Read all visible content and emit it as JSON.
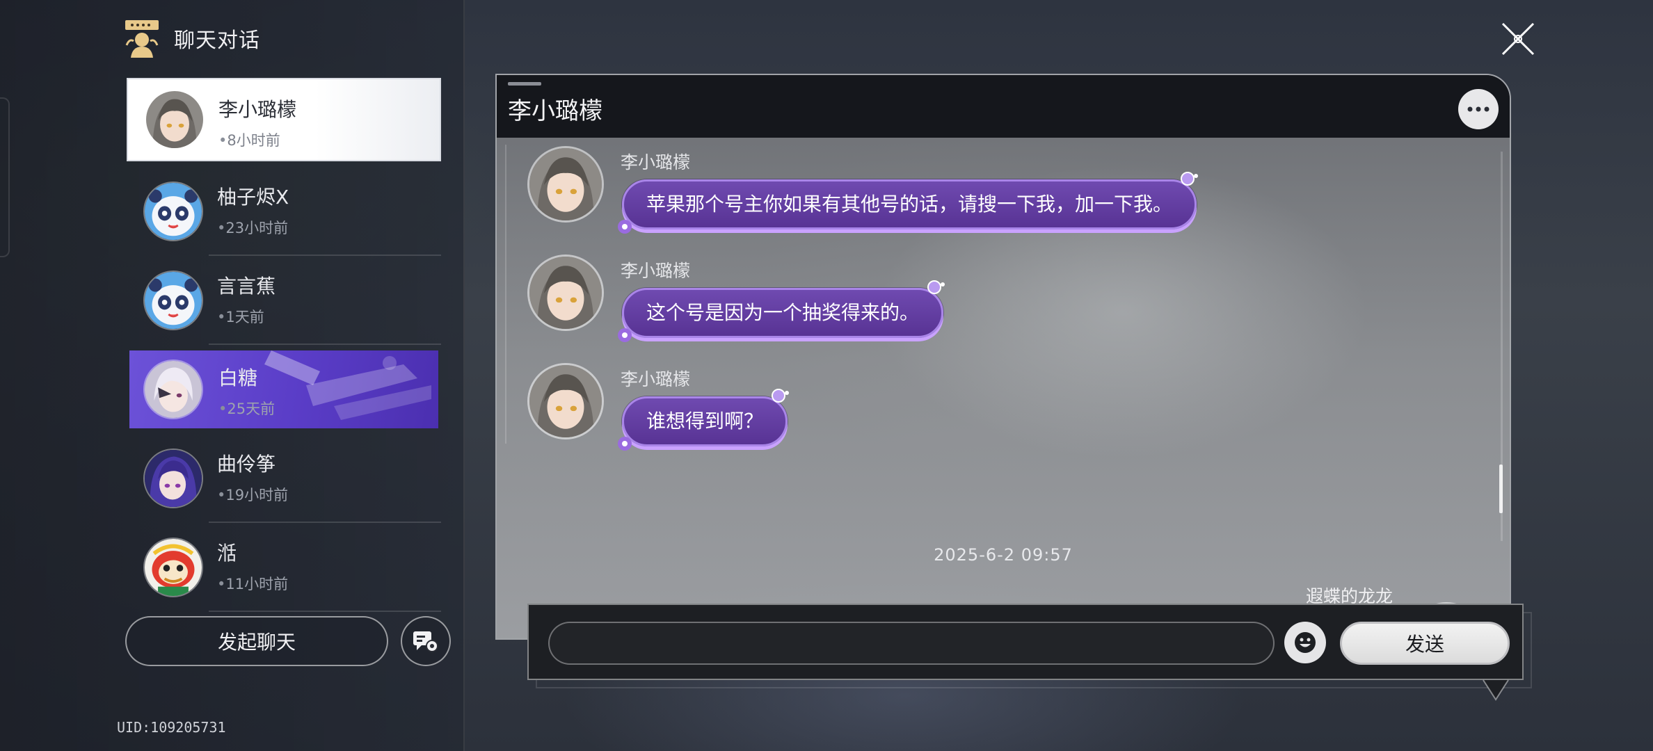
{
  "panel": {
    "title": "聊天对话",
    "icon": "chat-character-icon"
  },
  "contacts": [
    {
      "name": "李小璐檬",
      "time": "8小时前",
      "state": "active",
      "avatar": "gray-hair-girl"
    },
    {
      "name": "柚子烬X",
      "time": "23小时前",
      "state": "normal",
      "avatar": "panda-mascot"
    },
    {
      "name": "言言蕉",
      "time": "1天前",
      "state": "normal",
      "avatar": "panda-mascot"
    },
    {
      "name": "白糖",
      "time": "25天前",
      "state": "highlight",
      "avatar": "white-hair-girl"
    },
    {
      "name": "曲伶筝",
      "time": "19小时前",
      "state": "normal",
      "avatar": "purple-hair-girl"
    },
    {
      "name": "湉",
      "time": "11小时前",
      "state": "normal",
      "avatar": "lion-dance"
    }
  ],
  "actions": {
    "start_chat": "发起聊天",
    "settings_icon": "chat-settings-icon"
  },
  "uid": "UID:109205731",
  "chat": {
    "title": "李小璐檬",
    "messages": [
      {
        "sender": "李小璐檬",
        "text": "苹果那个号主你如果有其他号的话，请搜一下我，加一下我。"
      },
      {
        "sender": "李小璐檬",
        "text": "这个号是因为一个抽奖得来的。"
      },
      {
        "sender": "李小璐檬",
        "text": "谁想得到啊？"
      }
    ],
    "timestamp": "2025-6-2 09:57",
    "self_sender": "遐蝶的龙龙"
  },
  "input": {
    "placeholder": "",
    "value": "",
    "send_label": "发送"
  },
  "colors": {
    "bubble": "#5f3a9e",
    "bubble_border": "#a985e8",
    "highlight": "#5a3dc7"
  }
}
